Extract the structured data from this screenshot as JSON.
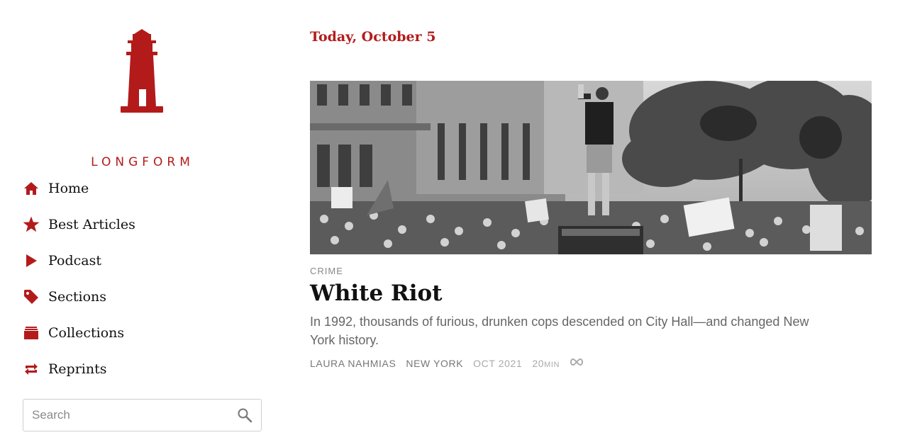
{
  "sidebar": {
    "logo_text": "LONGFORM",
    "nav": [
      {
        "label": "Home",
        "icon": "home-icon"
      },
      {
        "label": "Best Articles",
        "icon": "star-icon"
      },
      {
        "label": "Podcast",
        "icon": "play-icon"
      },
      {
        "label": "Sections",
        "icon": "tag-icon"
      },
      {
        "label": "Collections",
        "icon": "stack-icon"
      },
      {
        "label": "Reprints",
        "icon": "repeat-icon"
      }
    ],
    "search": {
      "placeholder": "Search",
      "icon": "search-icon"
    }
  },
  "main": {
    "date_heading": "Today, October 5",
    "article": {
      "category": "CRIME",
      "title": "White Riot",
      "summary": "In 1992, thousands of furious, drunken cops descended on City Hall—and changed New York history.",
      "author": "LAURA NAHMIAS",
      "publication": "NEW YORK",
      "date": "OCT 2021",
      "duration_value": "20",
      "duration_unit": "MIN",
      "link_icon": "infinity-icon"
    }
  },
  "colors": {
    "accent": "#b31b1b",
    "text": "#111111",
    "muted": "#888888"
  }
}
